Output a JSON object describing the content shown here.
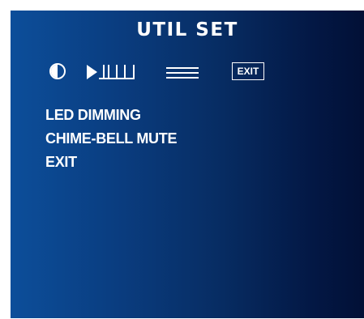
{
  "window": {
    "title": "UTIL SET"
  },
  "toolbar": {
    "icons": [
      "contrast-icon",
      "play-icon",
      "level-bars-icon",
      "lines-icon",
      "exit-icon"
    ],
    "exit_label": "EXIT"
  },
  "menu": {
    "items": [
      {
        "label": "LED DIMMING"
      },
      {
        "label": "CHIME-BELL MUTE"
      },
      {
        "label": "EXIT"
      }
    ]
  },
  "colors": {
    "panel_left": "#0c4e9a",
    "panel_right": "#021036",
    "text": "#ffffff"
  }
}
